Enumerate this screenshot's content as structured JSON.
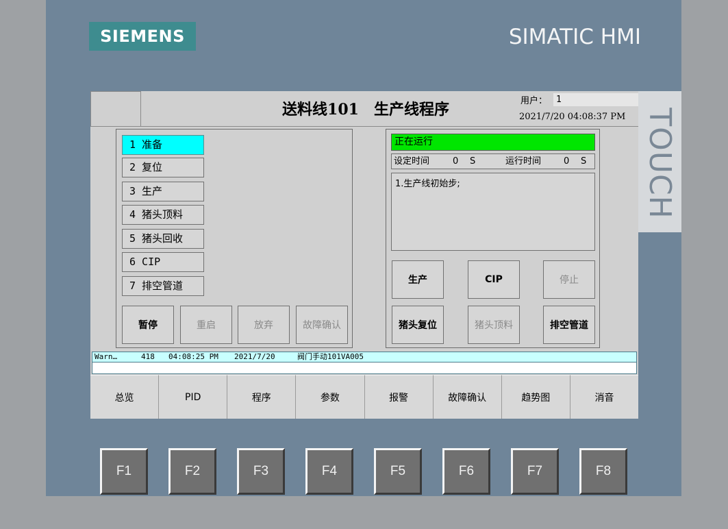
{
  "device": {
    "brand": "SIEMENS",
    "product": "SIMATIC HMI",
    "side_label": "TOUCH"
  },
  "header": {
    "title": "送料线101　生产线程序",
    "user_label": "用户：",
    "user_value": "1",
    "datetime": "2021/7/20 04:08:37 PM"
  },
  "steps": [
    {
      "label": "1 准备",
      "active": true
    },
    {
      "label": "2 复位",
      "active": false
    },
    {
      "label": "3 生产",
      "active": false
    },
    {
      "label": "4 猪头顶料",
      "active": false
    },
    {
      "label": "5 猪头回收",
      "active": false
    },
    {
      "label": "6 CIP",
      "active": false
    },
    {
      "label": "7 排空管道",
      "active": false
    }
  ],
  "step_controls": [
    {
      "label": "暂停",
      "enabled": true
    },
    {
      "label": "重启",
      "enabled": false
    },
    {
      "label": "放弃",
      "enabled": false
    },
    {
      "label": "故障确认",
      "enabled": false
    }
  ],
  "status": {
    "text": "正在运行",
    "color": "#00e600",
    "set_time_label": "设定时间",
    "set_time_value": "0",
    "set_time_unit": "S",
    "run_time_label": "运行时间",
    "run_time_value": "0",
    "run_time_unit": "S",
    "message": "1.生产线初始步;"
  },
  "program_buttons": [
    {
      "label": "生产",
      "enabled": true
    },
    {
      "label": "CIP",
      "enabled": true
    },
    {
      "label": "停止",
      "enabled": false
    },
    {
      "label": "猪头复位",
      "enabled": true
    },
    {
      "label": "猪头顶料",
      "enabled": false
    },
    {
      "label": "排空管道",
      "enabled": true
    }
  ],
  "alarm": {
    "type": "Warn…",
    "number": "418",
    "time": "04:08:25 PM",
    "date": "2021/7/20",
    "text": "阀门手动101VA005"
  },
  "nav": [
    "总览",
    "PID",
    "程序",
    "参数",
    "报警",
    "故障确认",
    "趋势图",
    "消音"
  ],
  "function_keys": [
    "F1",
    "F2",
    "F3",
    "F4",
    "F5",
    "F6",
    "F7",
    "F8"
  ]
}
